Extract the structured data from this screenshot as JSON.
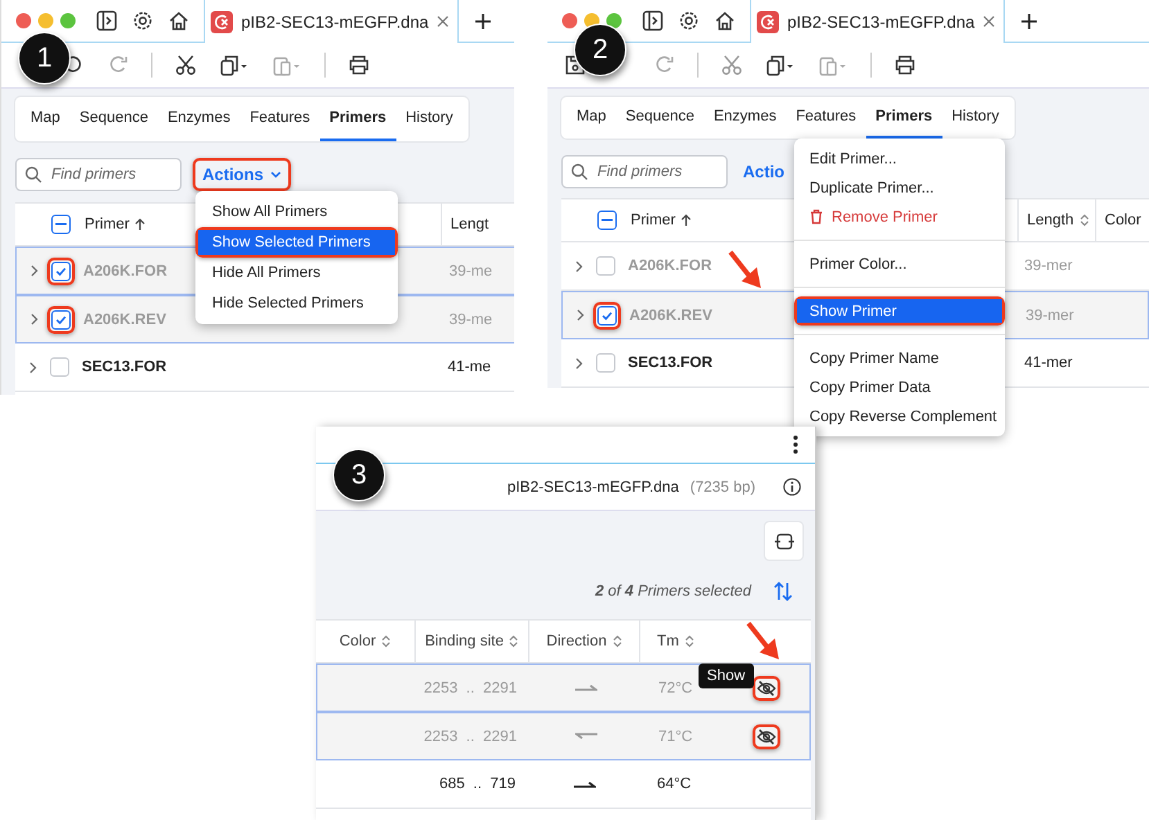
{
  "screenshot_1": {
    "step": "1",
    "file_tab": "pIB2-SEC13-mEGFP.dna",
    "view_tabs": [
      {
        "label": "Map",
        "selected": false
      },
      {
        "label": "Sequence",
        "selected": false
      },
      {
        "label": "Enzymes",
        "selected": false
      },
      {
        "label": "Features",
        "selected": false
      },
      {
        "label": "Primers",
        "selected": true
      },
      {
        "label": "History",
        "selected": false
      }
    ],
    "search": {
      "placeholder": "Find primers"
    },
    "actions": {
      "label": "Actions",
      "callout": true
    },
    "header_checkbox": {
      "indeterminate": true
    },
    "columns": [
      "Primer",
      "Lengt"
    ],
    "rows": [
      {
        "name": "A206K.FOR",
        "length": "39-me",
        "hidden": true,
        "checked": true,
        "selected": true,
        "callout": true
      },
      {
        "name": "A206K.REV",
        "length": "39-me",
        "hidden": true,
        "checked": true,
        "selected": true,
        "callout": true
      },
      {
        "name": "SEC13.FOR",
        "length": "41-me",
        "hidden": false,
        "checked": false,
        "selected": false,
        "callout": false
      }
    ],
    "menu": [
      {
        "kind": "item",
        "label": "Show All Primers",
        "highlighted": false,
        "callout": false
      },
      {
        "kind": "item",
        "label": "Show Selected Primers",
        "highlighted": true,
        "callout": true
      },
      {
        "kind": "item",
        "label": "Hide All Primers",
        "highlighted": false,
        "callout": false
      },
      {
        "kind": "item",
        "label": "Hide Selected Primers",
        "highlighted": false,
        "callout": false
      }
    ]
  },
  "screenshot_2": {
    "step": "2",
    "file_tab": "pIB2-SEC13-mEGFP.dna",
    "view_tabs": [
      {
        "label": "Map",
        "selected": false
      },
      {
        "label": "Sequence",
        "selected": false
      },
      {
        "label": "Enzymes",
        "selected": false
      },
      {
        "label": "Features",
        "selected": false
      },
      {
        "label": "Primers",
        "selected": true
      },
      {
        "label": "History",
        "selected": false
      }
    ],
    "search": {
      "placeholder": "Find primers"
    },
    "actions": {
      "label": "Actio",
      "callout": false
    },
    "header_checkbox": {
      "indeterminate": true
    },
    "columns": [
      "Primer",
      "Length",
      "Color"
    ],
    "rows": [
      {
        "name": "A206K.FOR",
        "length": "39-mer",
        "hidden": true,
        "checked": false,
        "selected": false,
        "callout": false
      },
      {
        "name": "A206K.REV",
        "length": "39-mer",
        "hidden": true,
        "checked": true,
        "selected": true,
        "callout": true
      },
      {
        "name": "SEC13.FOR",
        "length": "41-mer",
        "hidden": false,
        "checked": false,
        "selected": false,
        "callout": false
      }
    ],
    "menu": [
      {
        "kind": "item",
        "label": "Edit Primer...",
        "highlighted": false,
        "callout": false
      },
      {
        "kind": "item",
        "label": "Duplicate Primer...",
        "highlighted": false,
        "callout": false
      },
      {
        "kind": "danger",
        "label": "Remove Primer",
        "highlighted": false,
        "callout": false
      },
      {
        "kind": "separator"
      },
      {
        "kind": "item",
        "label": "Primer Color...",
        "highlighted": false,
        "callout": false
      },
      {
        "kind": "separator"
      },
      {
        "kind": "item",
        "label": "Show Primer",
        "highlighted": true,
        "callout": true
      },
      {
        "kind": "separator"
      },
      {
        "kind": "item",
        "label": "Copy Primer Name",
        "highlighted": false,
        "callout": false
      },
      {
        "kind": "item",
        "label": "Copy Primer Data",
        "highlighted": false,
        "callout": false
      },
      {
        "kind": "item",
        "label": "Copy Reverse Complement",
        "highlighted": false,
        "callout": false
      }
    ]
  },
  "screenshot_3": {
    "step": "3",
    "file_name": "pIB2-SEC13-mEGFP.dna",
    "file_size": "(7235 bp)",
    "selection": "**2** of **4** Primers selected",
    "columns": [
      "Color",
      "Binding site",
      "Direction",
      "Tm"
    ],
    "rows": [
      {
        "binding": "2253  ..  2291",
        "reverse": false,
        "tm": "72°C",
        "hidden": true,
        "selected": true,
        "callout": true
      },
      {
        "binding": "2253  ..  2291",
        "reverse": true,
        "tm": "71°C",
        "hidden": true,
        "selected": true,
        "callout": true
      },
      {
        "binding": "685  ..  719",
        "reverse": false,
        "tm": "64°C",
        "hidden": false,
        "selected": false,
        "callout": false
      }
    ],
    "tooltip": "Show"
  }
}
